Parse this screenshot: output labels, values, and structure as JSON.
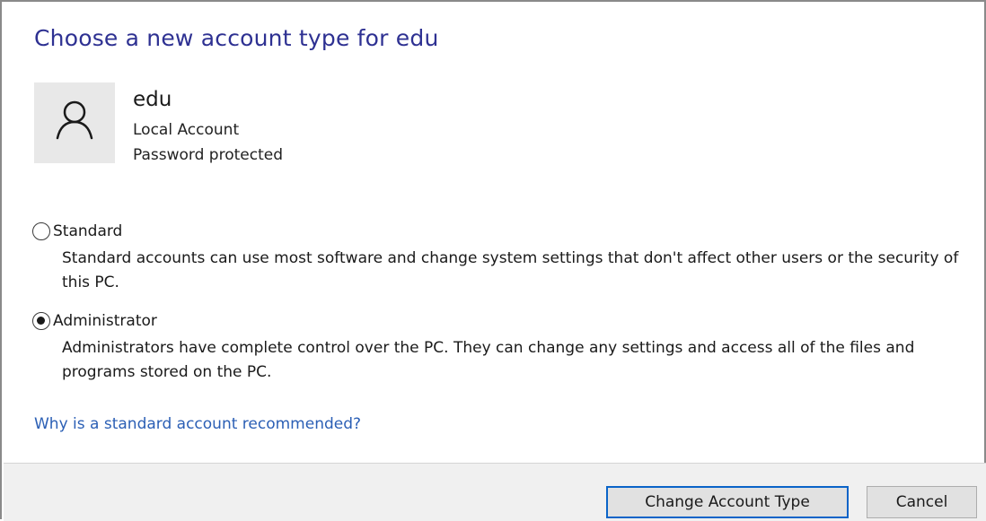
{
  "header": {
    "title": "Choose a new account type for edu"
  },
  "account": {
    "name": "edu",
    "type": "Local Account",
    "status": "Password protected",
    "avatar_icon": "user-icon"
  },
  "options": {
    "standard": {
      "label": "Standard",
      "description": "Standard accounts can use most software and change system settings that don't affect other users or the security of this PC.",
      "selected": false
    },
    "administrator": {
      "label": "Administrator",
      "description": "Administrators have complete control over the PC. They can change any settings and access all of the files and programs stored on the PC.",
      "selected": true
    }
  },
  "help_link": {
    "text": "Why is a standard account recommended?"
  },
  "footer": {
    "primary_label": "Change Account Type",
    "cancel_label": "Cancel"
  },
  "colors": {
    "title": "#2e3192",
    "link": "#2b5fb5",
    "primary_border": "#0a64c8"
  }
}
